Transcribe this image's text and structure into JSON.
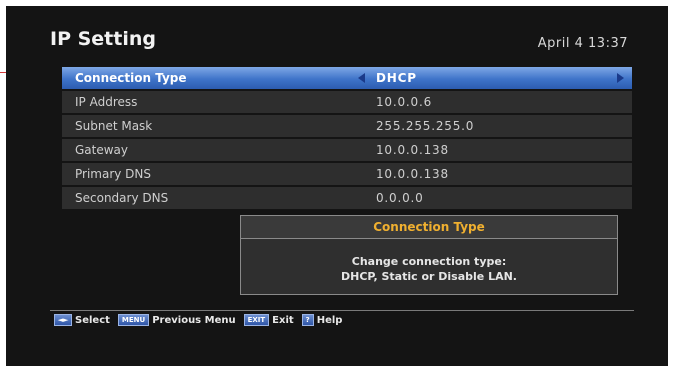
{
  "header": {
    "title": "IP Setting",
    "datetime": "April 4 13:37"
  },
  "settings": [
    {
      "label": "Connection Type",
      "value": "DHCP",
      "selected": true
    },
    {
      "label": "IP Address",
      "value": "10.0.0.6"
    },
    {
      "label": "Subnet Mask",
      "value": "255.255.255.0"
    },
    {
      "label": "Gateway",
      "value": "10.0.0.138"
    },
    {
      "label": "Primary DNS",
      "value": "10.0.0.138"
    },
    {
      "label": "Secondary DNS",
      "value": "0.0.0.0"
    }
  ],
  "info": {
    "title": "Connection Type",
    "line1": "Change connection type:",
    "line2": "DHCP, Static or Disable LAN."
  },
  "footer": {
    "select_key": "◄►",
    "select_label": "Select",
    "menu_key": "MENU",
    "menu_label": "Previous Menu",
    "exit_key": "EXIT",
    "exit_label": "Exit",
    "help_key": "?",
    "help_label": "Help"
  },
  "colors": {
    "selected_row": "#3f74c9",
    "row": "#2e2e2e",
    "info_title": "#f0b030",
    "background": "#141414"
  }
}
